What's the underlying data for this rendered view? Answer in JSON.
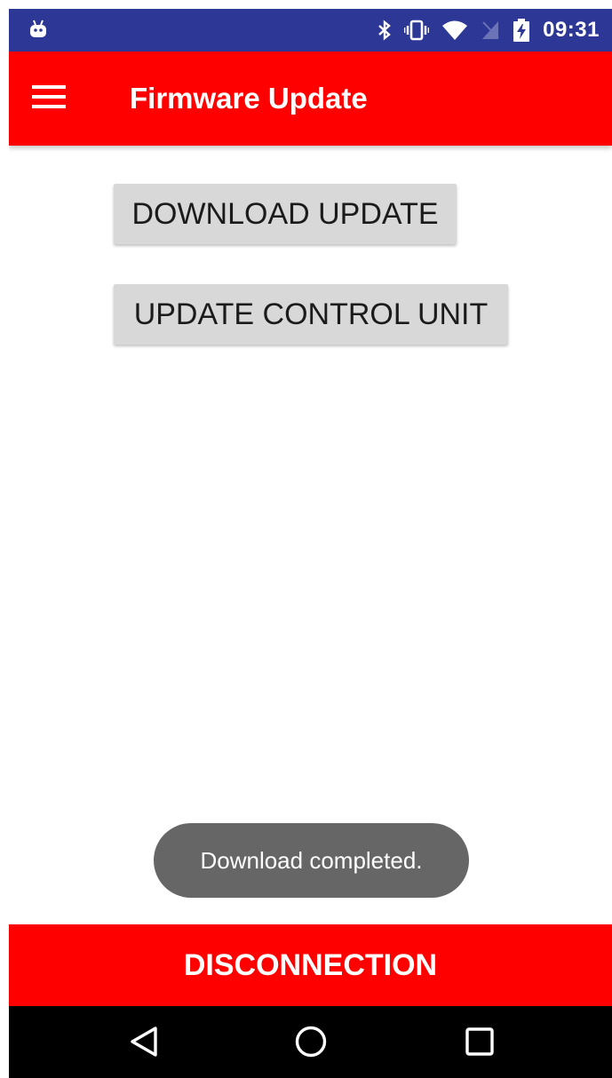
{
  "status_bar": {
    "time": "09:31",
    "icons": [
      "android-notification-icon",
      "bluetooth-icon",
      "vibrate-icon",
      "wifi-icon",
      "no-sim-icon",
      "battery-charging-icon"
    ],
    "background_color": "#2d3795"
  },
  "app_bar": {
    "title": "Firmware Update",
    "menu_icon": "hamburger-menu-icon",
    "background_color": "#ff0000"
  },
  "main": {
    "buttons": [
      {
        "label": "DOWNLOAD UPDATE"
      },
      {
        "label": "UPDATE CONTROL UNIT"
      }
    ]
  },
  "toast": {
    "message": "Download completed."
  },
  "footer": {
    "disconnect_label": "DISCONNECTION",
    "background_color": "#ff0000"
  },
  "nav_bar": {
    "icons": [
      "back-icon",
      "home-icon",
      "recents-icon"
    ]
  }
}
